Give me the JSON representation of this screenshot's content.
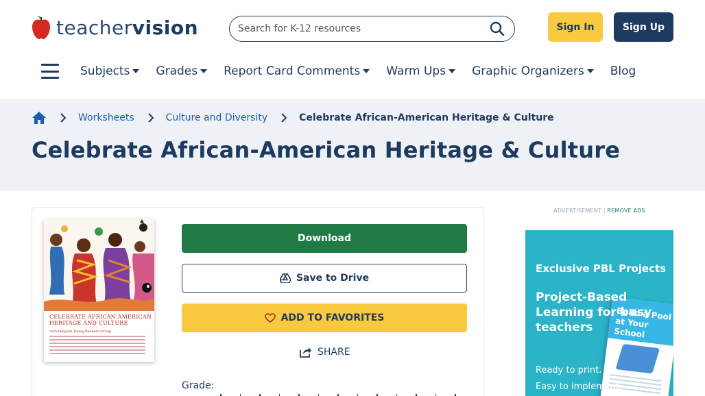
{
  "header": {
    "logo": {
      "text_light": "teacher",
      "text_bold": "vision",
      "icon": "apple-icon"
    },
    "search": {
      "placeholder": "Search for K-12 resources",
      "icon": "search-icon"
    },
    "sign_in": "Sign In",
    "sign_up": "Sign Up"
  },
  "nav": {
    "menu_icon": "hamburger-menu-icon",
    "items": [
      {
        "label": "Subjects",
        "dropdown": true
      },
      {
        "label": "Grades",
        "dropdown": true
      },
      {
        "label": "Report Card Comments",
        "dropdown": true
      },
      {
        "label": "Warm Ups",
        "dropdown": true
      },
      {
        "label": "Graphic Organizers",
        "dropdown": true
      },
      {
        "label": "Blog",
        "dropdown": false
      }
    ]
  },
  "breadcrumb": {
    "home_icon": "home-icon",
    "items": [
      "Worksheets",
      "Culture and Diversity",
      "Celebrate African-American Heritage & Culture"
    ]
  },
  "page": {
    "title": "Celebrate African-American Heritage & Culture"
  },
  "resource": {
    "thumbnail": {
      "title": "Celebrate African American Heritage and Culture",
      "subtitle": "with Penguin Young Readers Group"
    },
    "download_label": "Download",
    "drive_label": "Save to Drive",
    "favorites_label": "ADD TO FAVORITES",
    "share_label": "SHARE",
    "grade_label": "Grade:"
  },
  "ad": {
    "label": "ADVERTISEMENT |",
    "remove_label": "REMOVE ADS",
    "kicker": "Exclusive PBL Projects",
    "headline": "Project-Based Learning for busy teachers",
    "body_line1": "Ready to print.",
    "body_line2": "Easy to implement.",
    "book_title": "Build a Pool at Your School"
  },
  "colors": {
    "navy": "#1f3a5f",
    "yellow": "#f9c93f",
    "green": "#1f7a44",
    "link_blue": "#1a5fb4",
    "hero_bg": "#eef2f7",
    "ad_teal": "#2bb3c8"
  }
}
